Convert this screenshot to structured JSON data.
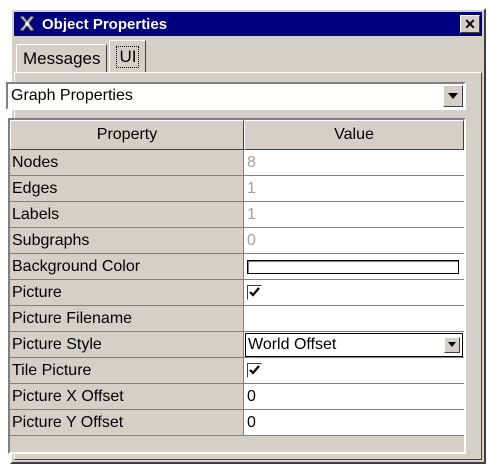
{
  "window": {
    "title": "Object Properties",
    "icon": "object-properties-icon",
    "close_icon": "close-icon"
  },
  "tabs": [
    {
      "label": "Messages",
      "active": false
    },
    {
      "label": "UI",
      "active": true
    }
  ],
  "dropdown": {
    "selected": "Graph Properties",
    "icon": "chevron-down-icon"
  },
  "table": {
    "headers": {
      "property": "Property",
      "value": "Value"
    },
    "rows": [
      {
        "property": "Nodes",
        "value": "8",
        "kind": "readonly"
      },
      {
        "property": "Edges",
        "value": "1",
        "kind": "readonly"
      },
      {
        "property": "Labels",
        "value": "1",
        "kind": "readonly"
      },
      {
        "property": "Subgraphs",
        "value": "0",
        "kind": "readonly"
      },
      {
        "property": "Background Color",
        "value": "",
        "kind": "color",
        "color": "#ffffff"
      },
      {
        "property": "Picture",
        "value": "",
        "kind": "checkbox",
        "checked": true
      },
      {
        "property": "Picture Filename",
        "value": "",
        "kind": "text"
      },
      {
        "property": "Picture Style",
        "value": "World Offset",
        "kind": "combo"
      },
      {
        "property": "Tile Picture",
        "value": "",
        "kind": "checkbox",
        "checked": true
      },
      {
        "property": "Picture X Offset",
        "value": "0",
        "kind": "text"
      },
      {
        "property": "Picture Y Offset",
        "value": "0",
        "kind": "text"
      }
    ]
  },
  "colors": {
    "titlebar": "#000080",
    "face": "#d4d0c8",
    "readonly_text": "#a0a0a0"
  }
}
